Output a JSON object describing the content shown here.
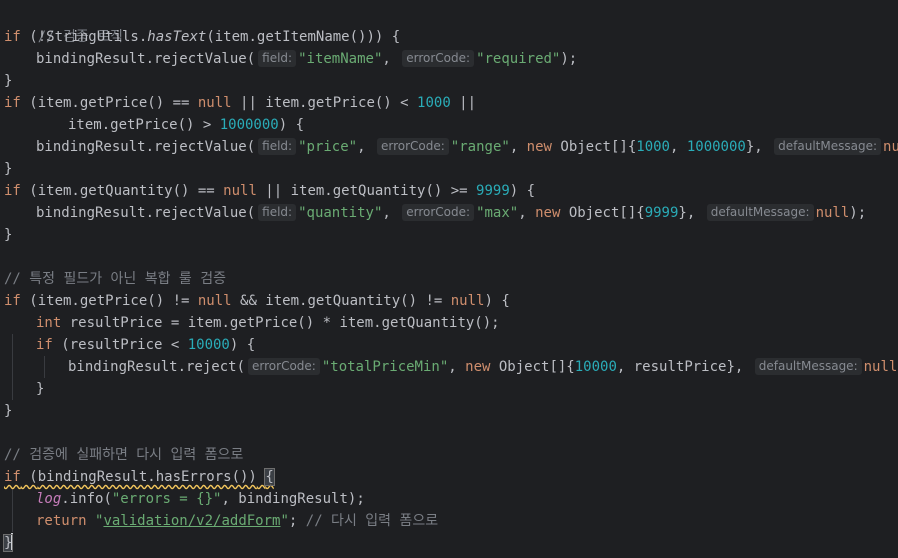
{
  "code": {
    "c1": "// 검증 로직",
    "if": "if",
    "l2a": " (!StringUtils.",
    "hasText": "hasText",
    "l2b": "(item.getItemName())) {",
    "brv": "bindingResult.rejectValue(",
    "br": "bindingResult.reject(",
    "hint_field": "field:",
    "hint_errorCode": "errorCode:",
    "hint_defaultMessage": "defaultMessage:",
    "s_itemName": "\"itemName\"",
    "s_required": "\"required\"",
    "s_price": "\"price\"",
    "s_range": "\"range\"",
    "s_quantity": "\"quantity\"",
    "s_max": "\"max\"",
    "s_totalPriceMin": "\"totalPriceMin\"",
    "comma_sp": ", ",
    "end_stmt": ");",
    "close": "}",
    "l5a": " (item.getPrice() == ",
    "null": "null",
    "l5b": " || item.getPrice() < ",
    "n1000": "1000",
    "l5c": " ||",
    "l6a": "item.getPrice() > ",
    "n1000000": "1000000",
    "l6b": ") {",
    "new": "new",
    "object_arr": " Object[]{",
    "l7sep": ", ",
    "arr_close": "}, ",
    "l9a": " (item.getQuantity() == ",
    "l9b": " || item.getQuantity() >= ",
    "n9999": "9999",
    "l9c": ") {",
    "c2": "// 특정 필드가 아닌 복합 룰 검증",
    "l13a": " (item.getPrice() != ",
    "l13b": " && item.getQuantity() != ",
    "l13c": ") {",
    "int": "int",
    "l14": " resultPrice = item.getPrice() * item.getQuantity();",
    "l15a": " (resultPrice < ",
    "n10000": "10000",
    "l15b": ") {",
    "l16mid": ", resultPrice}, ",
    "c3": "// 검증에 실패하면 다시 입력 폼으로",
    "l21a": " (",
    "l21b": "bindingResult.hasErrors())",
    "sp": " ",
    "open": "{",
    "log": "log",
    "l22a": ".info(",
    "s_errors": "\"errors = {}\"",
    "l22b": ", bindingResult);",
    "return": "return",
    "q": "\"",
    "path": "validation/v2/addForm",
    "semi": ";",
    "c4": " // 다시 입력 폼으로"
  }
}
